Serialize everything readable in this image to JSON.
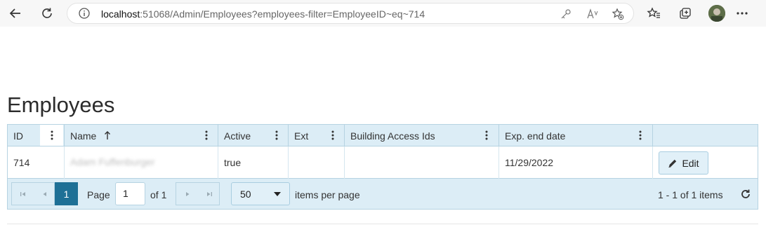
{
  "browser": {
    "url_host": "localhost",
    "url_rest": ":51068/Admin/Employees?employees-filter=EmployeeID~eq~714"
  },
  "page": {
    "title": "Employees"
  },
  "grid": {
    "columns": [
      {
        "label": "ID"
      },
      {
        "label": "Name"
      },
      {
        "label": "Active"
      },
      {
        "label": "Ext"
      },
      {
        "label": "Building Access Ids"
      },
      {
        "label": "Exp. end date"
      },
      {
        "label": ""
      }
    ],
    "rows": [
      {
        "id": "714",
        "name": "Adam Fuffenburger",
        "active": "true",
        "ext": "",
        "building_access_ids": "",
        "exp_end_date": "11/29/2022",
        "edit_label": "Edit"
      }
    ]
  },
  "pager": {
    "current_page": "1",
    "page_label": "Page",
    "page_input_value": "1",
    "of_label": "of 1",
    "page_size": "50",
    "items_per_page_label": "items per page",
    "info": "1 - 1 of 1 items"
  },
  "colors": {
    "header_bg": "#dcedf6",
    "border": "#b6d3e2",
    "selected_page": "#1e7096"
  }
}
